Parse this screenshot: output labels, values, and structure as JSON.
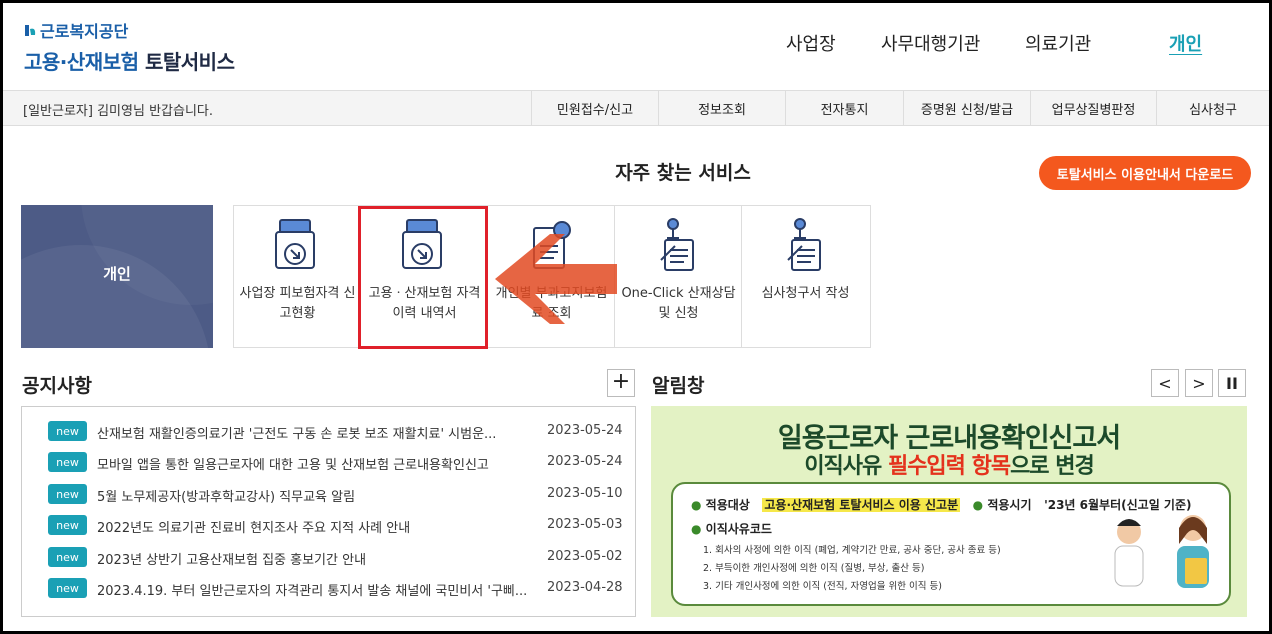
{
  "header": {
    "org_name": "근로복지공단",
    "service_name_a": "고용·산재보험",
    "service_name_b": "토탈서비스",
    "nav": [
      {
        "label": "사업장",
        "active": false
      },
      {
        "label": "사무대행기관",
        "active": false
      },
      {
        "label": "의료기관",
        "active": false
      },
      {
        "label": "개인",
        "active": true
      }
    ]
  },
  "userbar": {
    "role": "[일반근로자]",
    "name": "김미영",
    "greeting": "님 반갑습니다.",
    "menu": [
      "민원접수/신고",
      "정보조회",
      "전자통지",
      "증명원 신청/발급",
      "업무상질병판정",
      "심사청구"
    ]
  },
  "frequent": {
    "title": "자주 찾는 서비스",
    "download_button": "토탈서비스 이용안내서 다운로드",
    "category": "개인",
    "items": [
      {
        "label": "사업장 피보험자격 신고현황",
        "icon": "folder-download-icon"
      },
      {
        "label": "고용ㆍ산재보험 자격 이력 내역서",
        "icon": "folder-download-icon"
      },
      {
        "label": "개인별 부과고지보험료 조회",
        "icon": "document-search-icon"
      },
      {
        "label": "One-Click 산재상담 및 신청",
        "icon": "pen-document-icon"
      },
      {
        "label": "심사청구서 작성",
        "icon": "pen-document-icon"
      }
    ]
  },
  "notices": {
    "title": "공지사항",
    "more": "+",
    "badge": "new",
    "items": [
      {
        "text": "산재보험 재활인증의료기관 '근전도 구동 손 로봇 보조 재활치료' 시범운...",
        "date": "2023-05-24"
      },
      {
        "text": "모바일 앱을 통한 일용근로자에 대한 고용 및 산재보험 근로내용확인신고",
        "date": "2023-05-24"
      },
      {
        "text": "5월 노무제공자(방과후학교강사) 직무교육 알림",
        "date": "2023-05-10"
      },
      {
        "text": "2022년도 의료기관 진료비 현지조사 주요 지적 사례 안내",
        "date": "2023-05-03"
      },
      {
        "text": "2023년 상반기 고용산재보험 집중 홍보기간 안내",
        "date": "2023-05-02"
      },
      {
        "text": "2023.4.19. 부터 일반근로자의 자격관리 통지서 발송 채널에 국민비서 '구삐...",
        "date": "2023-04-28"
      }
    ]
  },
  "alerts": {
    "title": "알림창",
    "prev": "<",
    "next": ">",
    "pause": "II",
    "banner": {
      "line1": "일용근로자 근로내용확인신고서",
      "line2_a": "이직사유",
      "line2_b": "필수입력 항목",
      "line2_c": "으로 변경",
      "scope_label": "적용대상",
      "scope_value": "고용·산재보험 토탈서비스 이용 신고분",
      "period_label": "적용시기",
      "period_value": "'23년 6월부터(신고일 기준)",
      "code_label": "이직사유코드",
      "codes": [
        "1. 회사의 사정에 의한 이직 (폐업, 계약기간 만료, 공사 중단, 공사 종료 등)",
        "2. 부득이한 개인사정에 의한 이직 (질병, 부상, 출산 등)",
        "3. 기타 개인사정에 의한 이직 (전직, 자영업을 위한 이직 등)"
      ]
    }
  },
  "colors": {
    "accent": "#1aa0b5",
    "brand": "#1a5fa8",
    "orange": "#f4581e",
    "highlight": "#e0202a"
  }
}
